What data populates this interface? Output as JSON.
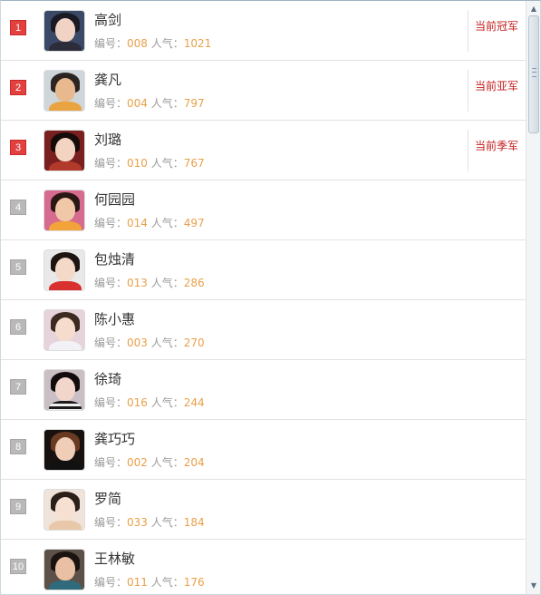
{
  "labels": {
    "id_label": "编号：",
    "pop_label": "人气："
  },
  "rows": [
    {
      "rank": "1",
      "name": "高剑",
      "id": "008",
      "pop": "1021",
      "badge": "当前冠军"
    },
    {
      "rank": "2",
      "name": "龚凡",
      "id": "004",
      "pop": "797",
      "badge": "当前亚军"
    },
    {
      "rank": "3",
      "name": "刘璐",
      "id": "010",
      "pop": "767",
      "badge": "当前季军"
    },
    {
      "rank": "4",
      "name": "何园园",
      "id": "014",
      "pop": "497",
      "badge": ""
    },
    {
      "rank": "5",
      "name": "包烛清",
      "id": "013",
      "pop": "286",
      "badge": ""
    },
    {
      "rank": "6",
      "name": "陈小惠",
      "id": "003",
      "pop": "270",
      "badge": ""
    },
    {
      "rank": "7",
      "name": "徐琦",
      "id": "016",
      "pop": "244",
      "badge": ""
    },
    {
      "rank": "8",
      "name": "龚巧巧",
      "id": "002",
      "pop": "204",
      "badge": ""
    },
    {
      "rank": "9",
      "name": "罗简",
      "id": "033",
      "pop": "184",
      "badge": ""
    },
    {
      "rank": "10",
      "name": "王林敏",
      "id": "011",
      "pop": "176",
      "badge": ""
    }
  ],
  "colors": {
    "rank_top": "#e34040",
    "rank_normal": "#b9b9b9",
    "badge": "#c21e1e",
    "number": "#e8a04a",
    "label": "#9a9a9a"
  },
  "icons": {
    "scroll_up": "scroll-up-arrow-icon",
    "scroll_down": "scroll-down-arrow-icon",
    "avatar": "user-photo"
  }
}
